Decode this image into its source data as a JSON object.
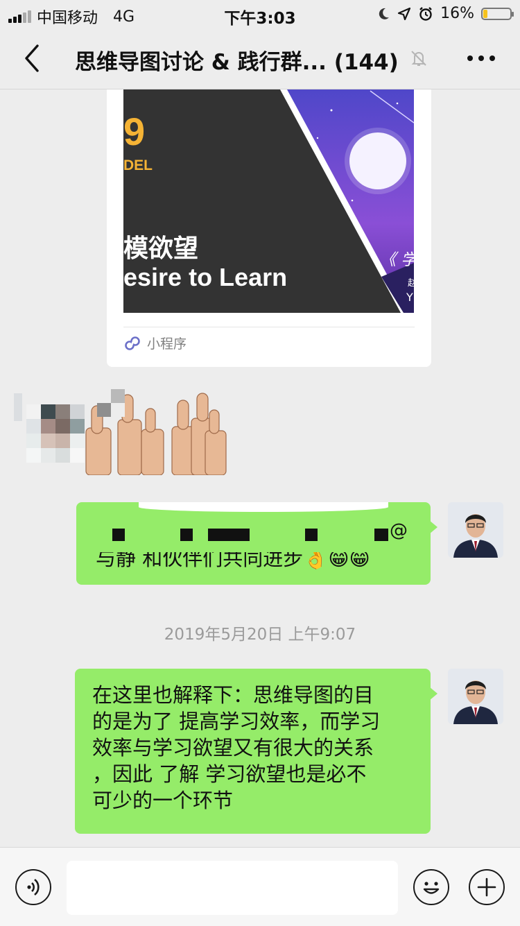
{
  "status_bar": {
    "carrier": "中国移动",
    "network": "4G",
    "time": "下午3:03",
    "battery": "16%",
    "battery_level": 0.16
  },
  "nav": {
    "title": "思维导图讨论 & 践行群... (144)"
  },
  "mini_program_card": {
    "image_texts": {
      "number": "9",
      "model": "DEL",
      "cn_title": "模欲望",
      "en_title": "esire to Learn",
      "right_text": "《 学",
      "right_small_1": "赵",
      "right_small_2": "Y"
    },
    "footer_label": "小程序"
  },
  "messages": [
    {
      "type": "text",
      "sender": "self",
      "text": "与静 和伙伴们共同进步",
      "emojis": "👌😁😁",
      "mention": "@"
    },
    {
      "type": "timestamp",
      "text": "2019年5月20日 上午9:07"
    },
    {
      "type": "text",
      "sender": "self",
      "lines": [
        "在这里也解释下：思维导图的目",
        "的是为了 提高学习效率，而学习",
        "效率与学习欲望又有很大的关系",
        "，因此 了解 学习欲望也是必不",
        "可少的一个环节"
      ]
    }
  ],
  "input_bar": {
    "value": "",
    "placeholder": ""
  },
  "colors": {
    "background": "#ededed",
    "bubble_self": "#95ec69",
    "card_bg": "#ffffff",
    "timestamp": "#9a9a9a",
    "battery_fill": "#f6c21c"
  },
  "icons": {
    "back": "chevron-left-icon",
    "mute": "bell-mute-icon",
    "more": "more-dots-icon",
    "voice": "voice-icon",
    "emoji": "emoji-icon",
    "add": "plus-icon",
    "mini_program": "mini-program-icon"
  }
}
